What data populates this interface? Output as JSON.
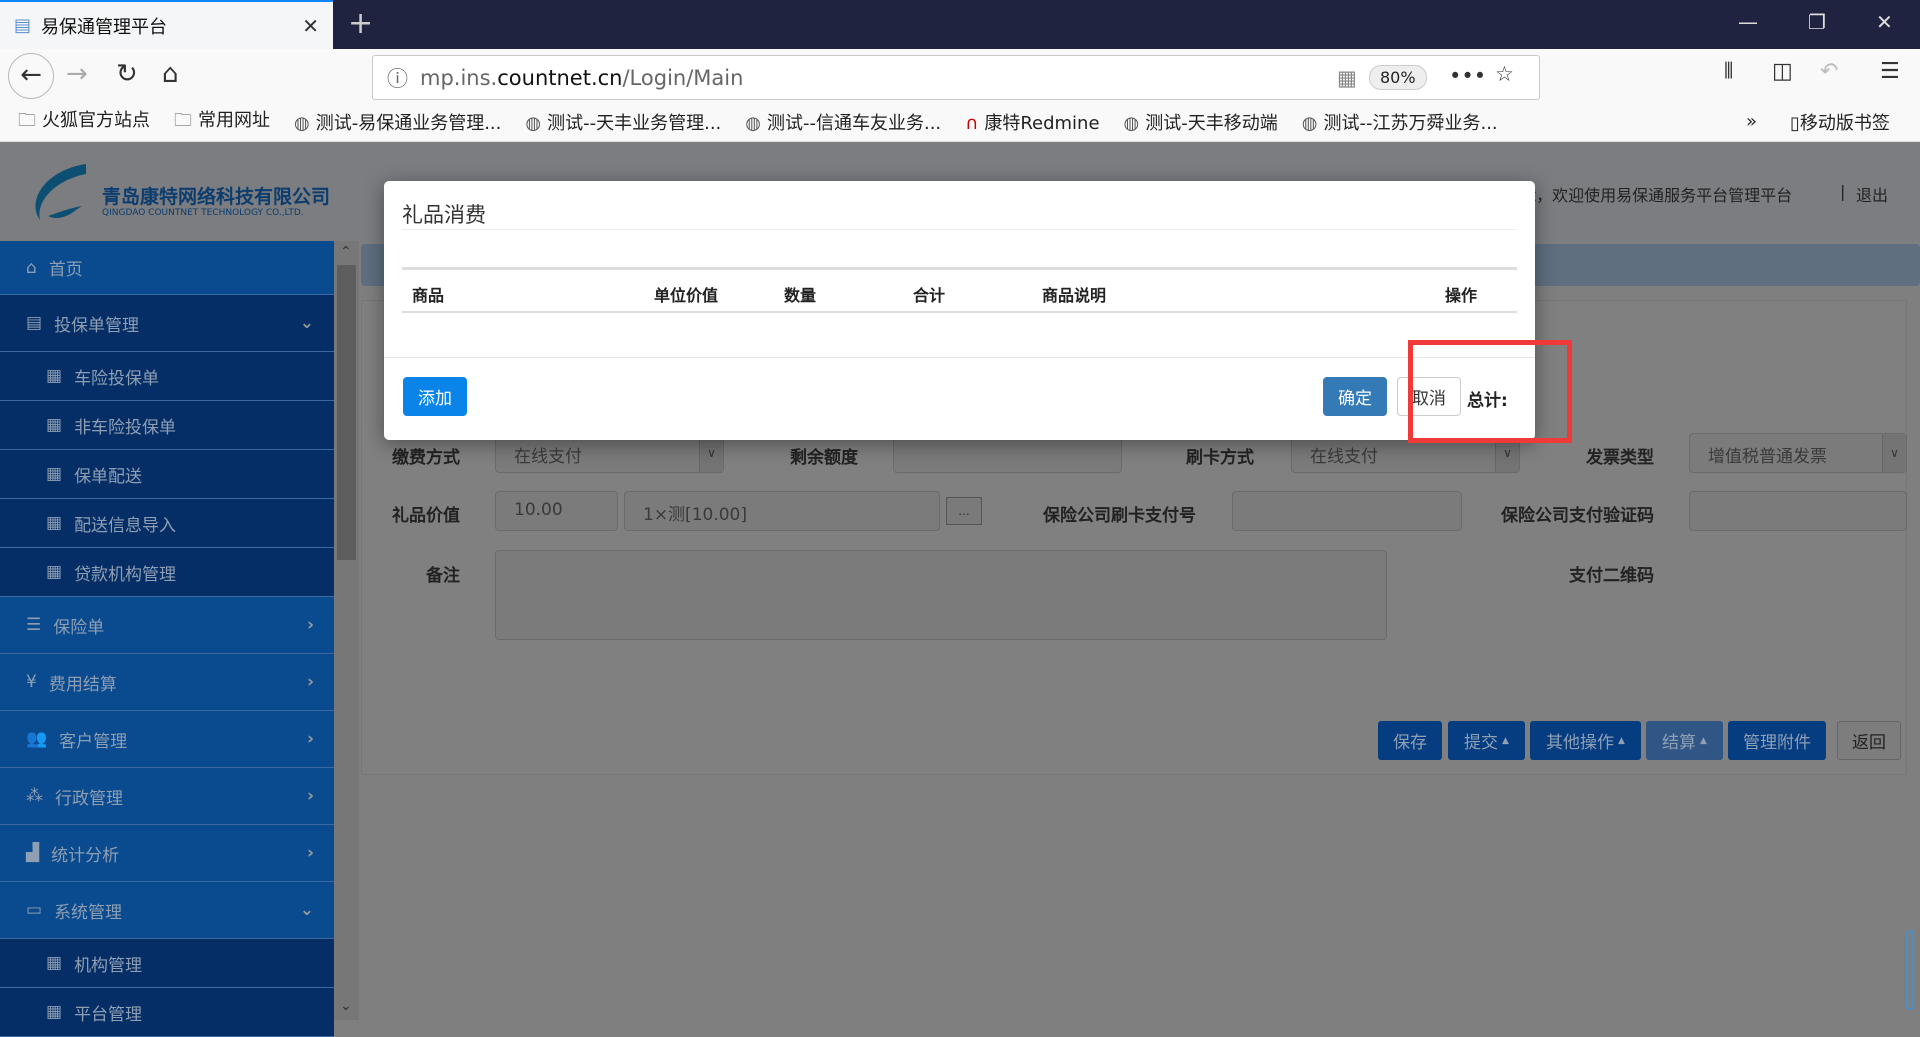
{
  "browser": {
    "tab_title": "易保通管理平台",
    "url_prefix": "mp.ins.",
    "url_domain": "countnet.cn",
    "url_path": "/Login/Main",
    "zoom": "80%",
    "bookmarks": [
      "火狐官方站点",
      "常用网址",
      "测试-易保通业务管理...",
      "测试--天丰业务管理...",
      "测试--信通车友业务...",
      "康特Redmine",
      "测试-天丰移动端",
      "测试--江苏万舜业务..."
    ],
    "mobile_bookmarks": "移动版书签"
  },
  "header": {
    "company_cn": "青岛康特网络科技有限公司",
    "company_en": "QINGDAO COUNTNET TECHNOLOGY CO.,LTD.",
    "welcome": "ot，欢迎使用易保通服务平台管理平台",
    "logout": "退出"
  },
  "sidebar": {
    "items": [
      {
        "label": "首页"
      },
      {
        "label": "投保单管理"
      },
      {
        "label": "车险投保单"
      },
      {
        "label": "非车险投保单"
      },
      {
        "label": "保单配送"
      },
      {
        "label": "配送信息导入"
      },
      {
        "label": "贷款机构管理"
      },
      {
        "label": "保险单"
      },
      {
        "label": "费用结算"
      },
      {
        "label": "客户管理"
      },
      {
        "label": "行政管理"
      },
      {
        "label": "统计分析"
      },
      {
        "label": "系统管理"
      },
      {
        "label": "机构管理"
      },
      {
        "label": "平台管理"
      }
    ]
  },
  "form": {
    "payment_method_label": "缴费方式",
    "payment_method": "在线支付",
    "remaining_label": "剩余额度",
    "card_method_label": "刷卡方式",
    "card_method": "在线支付",
    "invoice_label": "发票类型",
    "invoice": "增值税普通发票",
    "gift_value_label": "礼品价值",
    "gift_value": "10.00",
    "gift_detail": "1×测[10.00]",
    "more": "...",
    "card_no_label": "保险公司刷卡支付号",
    "verify_label": "保险公司支付验证码",
    "remark_label": "备注",
    "qr_label": "支付二维码"
  },
  "actions": {
    "save": "保存",
    "submit": "提交",
    "other": "其他操作",
    "settle": "结算",
    "attach": "管理附件",
    "back": "返回"
  },
  "modal": {
    "title": "礼品消费",
    "columns": [
      "商品",
      "单位价值",
      "数量",
      "合计",
      "商品说明",
      "操作"
    ],
    "add": "添加",
    "ok": "确定",
    "cancel": "取消",
    "total_label": "总计:"
  }
}
